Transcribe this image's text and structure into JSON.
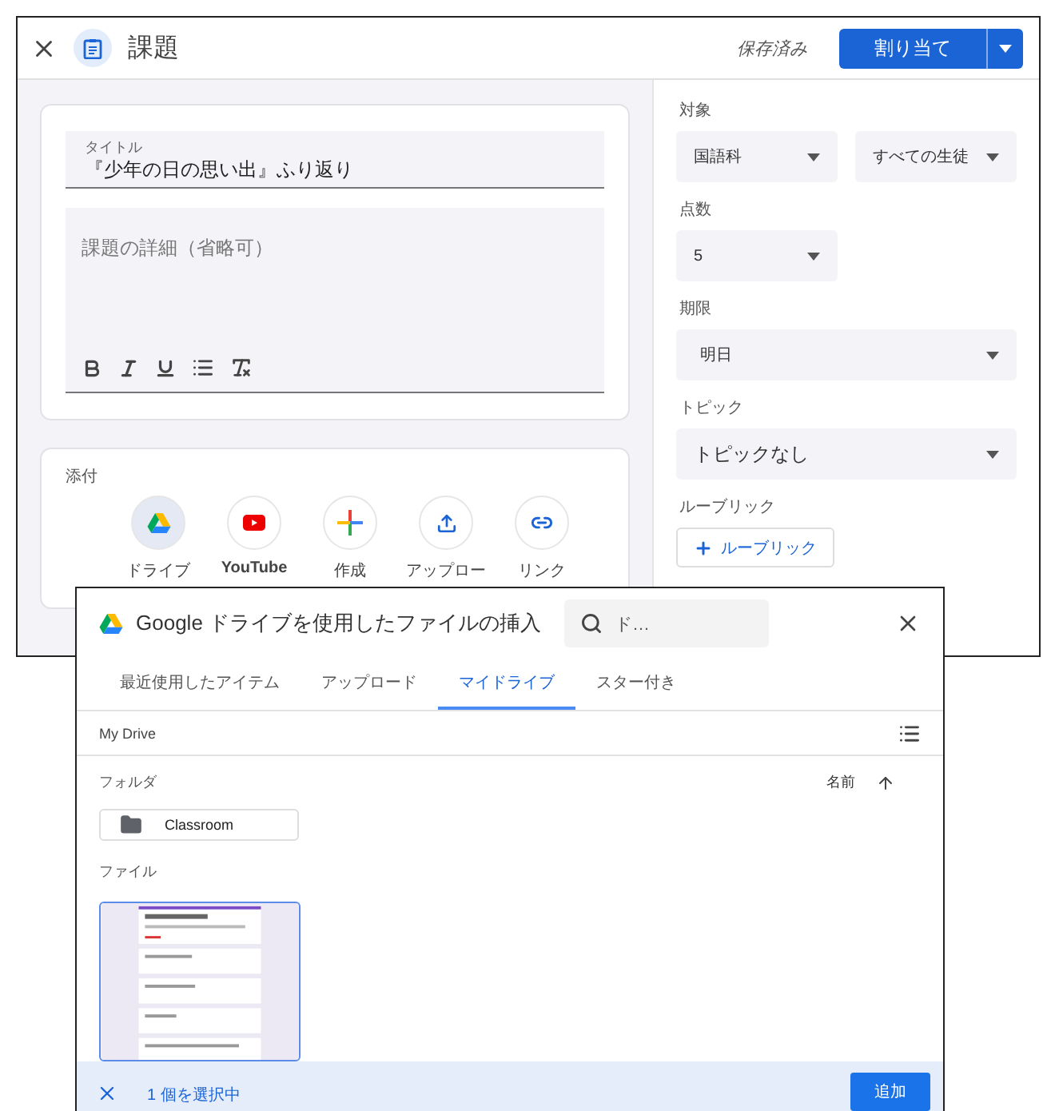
{
  "header": {
    "title": "課題",
    "status": "保存済み",
    "assign_button": "割り当て"
  },
  "title_field": {
    "label": "タイトル",
    "value": "『少年の日の思い出』ふり返り"
  },
  "details_field": {
    "placeholder": "課題の詳細（省略可）"
  },
  "attachments": {
    "label": "添付",
    "items": [
      {
        "kind": "drive",
        "label": "ドライブ",
        "selected": true
      },
      {
        "kind": "youtube",
        "label": "YouTube",
        "selected": false
      },
      {
        "kind": "create",
        "label": "作成",
        "selected": false
      },
      {
        "kind": "upload",
        "label": "アップロー",
        "selected": false
      },
      {
        "kind": "link",
        "label": "リンク",
        "selected": false
      }
    ]
  },
  "settings": [
    {
      "label": "対象",
      "controls": [
        {
          "kind": "select",
          "value": "国語科"
        },
        {
          "kind": "select",
          "value": "すべての生徒"
        }
      ]
    },
    {
      "label": "点数",
      "controls": [
        {
          "kind": "select",
          "value": "5"
        }
      ]
    },
    {
      "label": "期限",
      "controls": [
        {
          "kind": "date",
          "value": "明日"
        }
      ]
    },
    {
      "label": "トピック",
      "controls": [
        {
          "kind": "topic",
          "value": "トピックなし"
        }
      ]
    },
    {
      "label": "ルーブリック",
      "controls": [
        {
          "kind": "button",
          "value": "ルーブリック"
        }
      ]
    }
  ],
  "dialog": {
    "title": "Google ドライブを使用したファイルの挿入",
    "search": {
      "value": "ド…"
    },
    "tabs": [
      {
        "label": "最近使用したアイテム",
        "selected": false
      },
      {
        "label": "アップロード",
        "selected": false
      },
      {
        "label": "マイドライブ",
        "selected": true
      },
      {
        "label": "スター付き",
        "selected": false
      }
    ],
    "breadcrumb": "My Drive",
    "folders_heading": "フォルダ",
    "sort_label": "名前",
    "folders": [
      {
        "name": "Classroom"
      }
    ],
    "files_heading": "ファイル",
    "files": [
      {
        "kind": "picture",
        "selected": true
      }
    ],
    "footer": {
      "selection": "1 個を選択中",
      "add_button": "追加"
    }
  }
}
